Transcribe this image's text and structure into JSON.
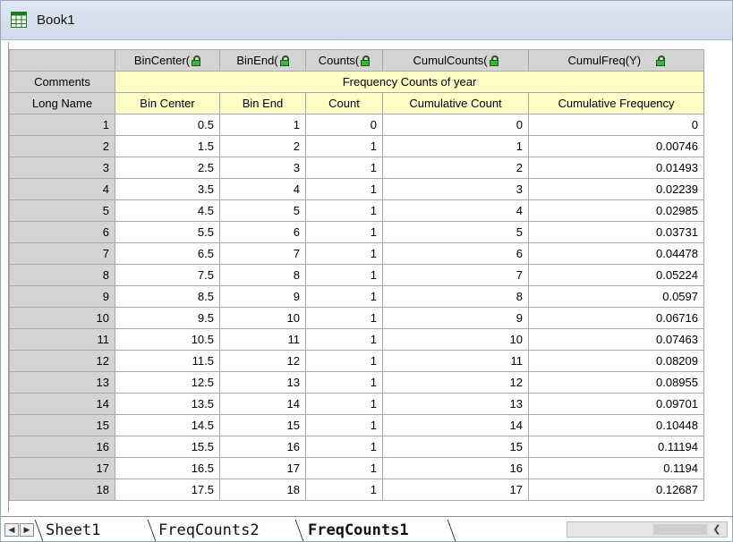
{
  "window": {
    "title": "Book1"
  },
  "columns": [
    {
      "short": "BinCenter(",
      "long": "Bin Center"
    },
    {
      "short": "BinEnd(",
      "long": "Bin End"
    },
    {
      "short": "Counts(",
      "long": "Count"
    },
    {
      "short": "CumulCounts(",
      "long": "Cumulative Count"
    },
    {
      "short": "CumulFreq(Y)",
      "long": "Cumulative Frequency"
    }
  ],
  "row_labels": {
    "comments": "Comments",
    "long_name": "Long Name"
  },
  "comments_text": "Frequency Counts of year",
  "rows": [
    [
      "1",
      "0.5",
      "1",
      "0",
      "0",
      "0"
    ],
    [
      "2",
      "1.5",
      "2",
      "1",
      "1",
      "0.00746"
    ],
    [
      "3",
      "2.5",
      "3",
      "1",
      "2",
      "0.01493"
    ],
    [
      "4",
      "3.5",
      "4",
      "1",
      "3",
      "0.02239"
    ],
    [
      "5",
      "4.5",
      "5",
      "1",
      "4",
      "0.02985"
    ],
    [
      "6",
      "5.5",
      "6",
      "1",
      "5",
      "0.03731"
    ],
    [
      "7",
      "6.5",
      "7",
      "1",
      "6",
      "0.04478"
    ],
    [
      "8",
      "7.5",
      "8",
      "1",
      "7",
      "0.05224"
    ],
    [
      "9",
      "8.5",
      "9",
      "1",
      "8",
      "0.0597"
    ],
    [
      "10",
      "9.5",
      "10",
      "1",
      "9",
      "0.06716"
    ],
    [
      "11",
      "10.5",
      "11",
      "1",
      "10",
      "0.07463"
    ],
    [
      "12",
      "11.5",
      "12",
      "1",
      "11",
      "0.08209"
    ],
    [
      "13",
      "12.5",
      "13",
      "1",
      "12",
      "0.08955"
    ],
    [
      "14",
      "13.5",
      "14",
      "1",
      "13",
      "0.09701"
    ],
    [
      "15",
      "14.5",
      "15",
      "1",
      "14",
      "0.10448"
    ],
    [
      "16",
      "15.5",
      "16",
      "1",
      "15",
      "0.11194"
    ],
    [
      "17",
      "16.5",
      "17",
      "1",
      "16",
      "0.1194"
    ],
    [
      "18",
      "17.5",
      "18",
      "1",
      "17",
      "0.12687"
    ]
  ],
  "sheet_tabs": [
    "Sheet1",
    "FreqCounts2",
    "FreqCounts1"
  ],
  "active_tab": "FreqCounts1",
  "colors": {
    "title_bg": "#d8e3ef",
    "meta_bg": "#ffffc8",
    "header_bg": "#d4d4d4",
    "lock_green": "#3db33d"
  }
}
